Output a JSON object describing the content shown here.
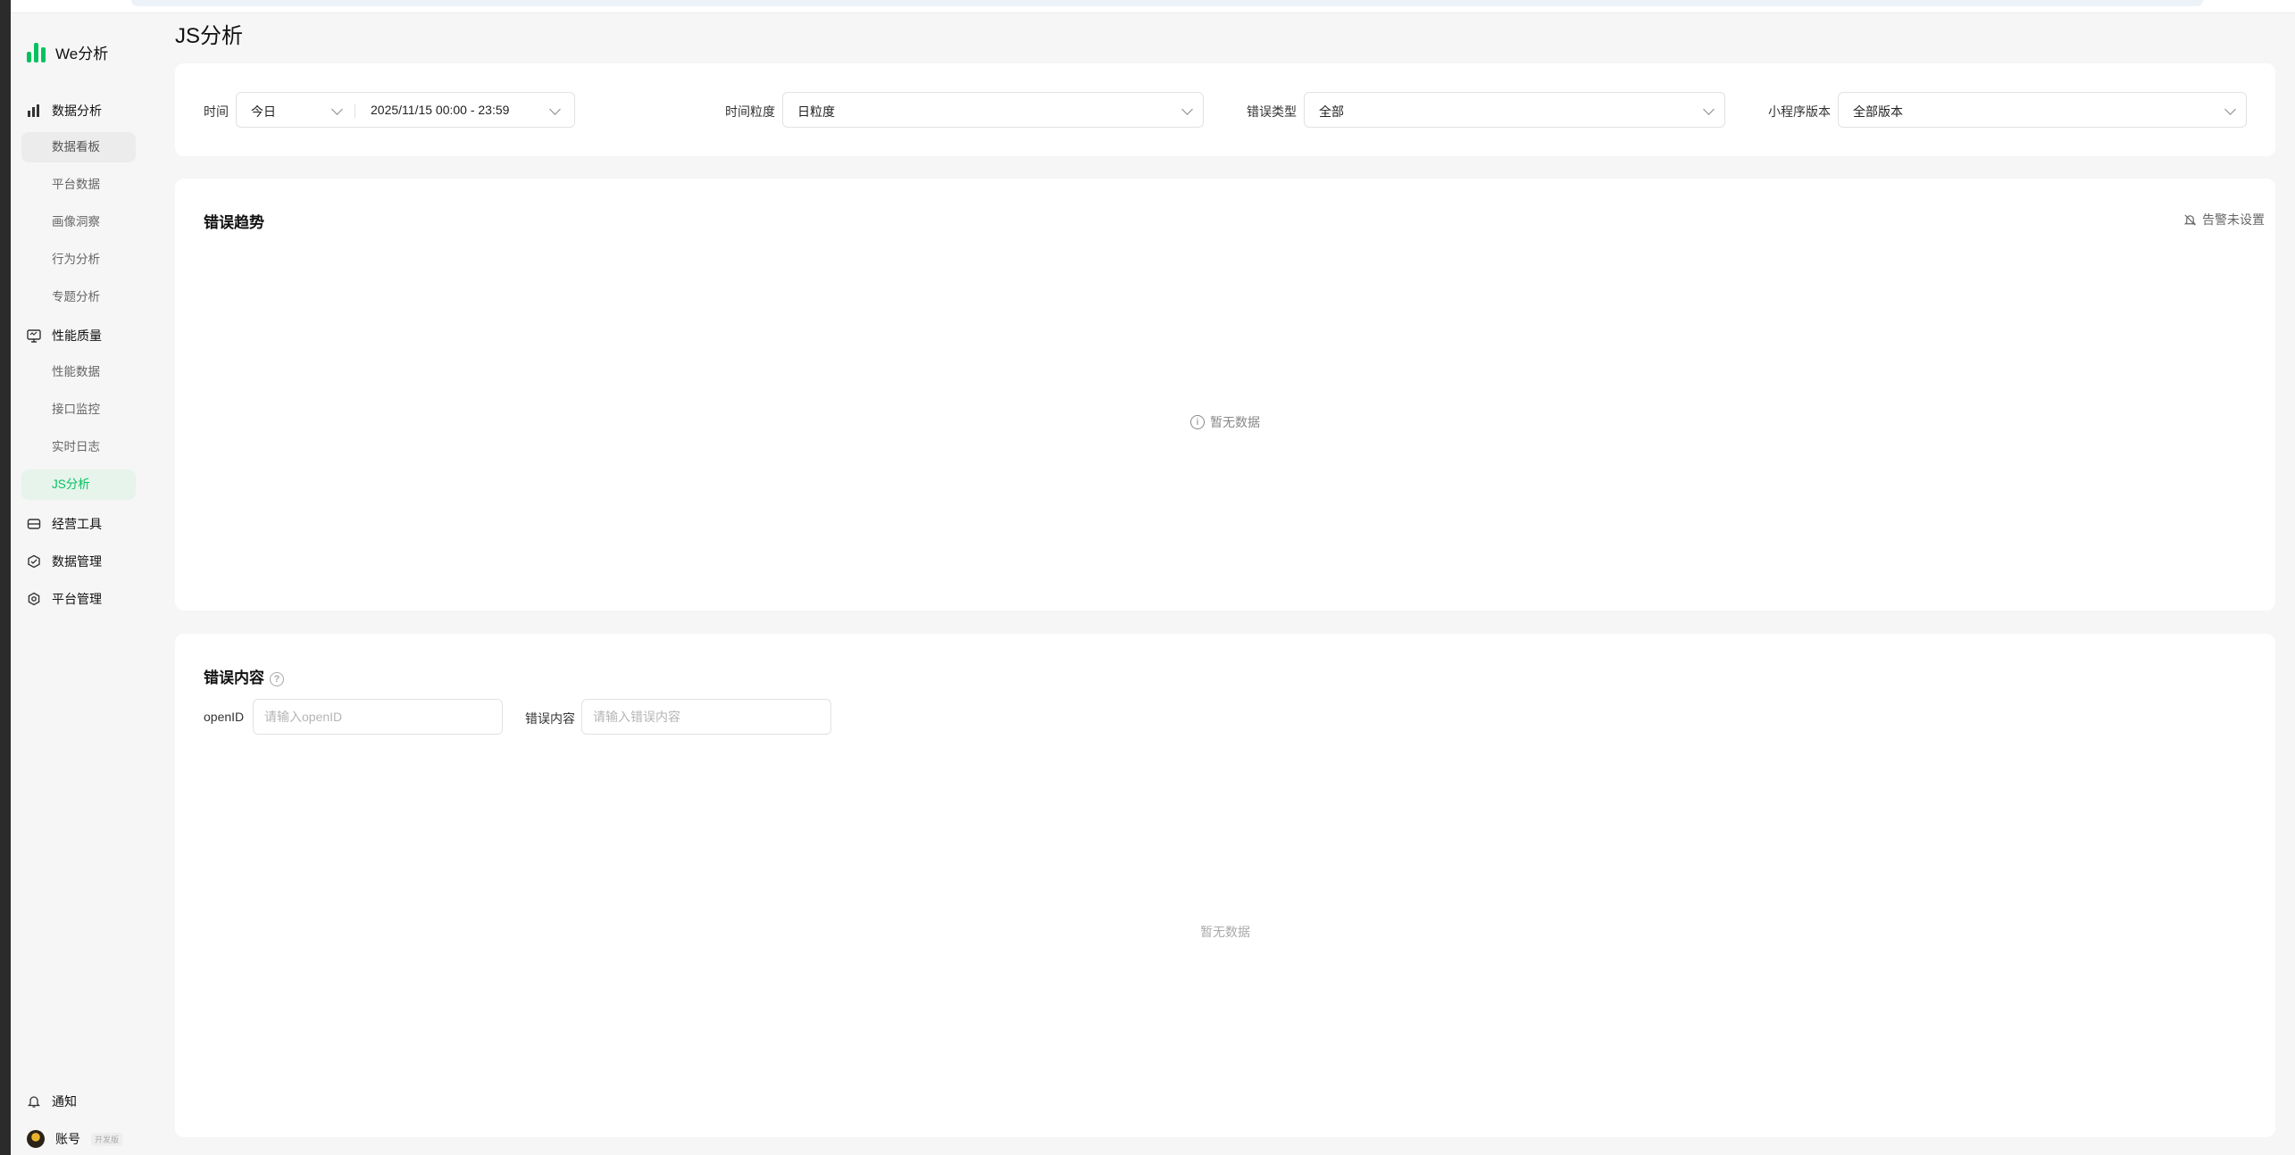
{
  "sidebar": {
    "brand": "We分析",
    "groups": {
      "data_analysis": {
        "label": "数据分析",
        "items": [
          "数据看板",
          "平台数据",
          "画像洞察",
          "行为分析",
          "专题分析"
        ]
      },
      "performance": {
        "label": "性能质量",
        "items": [
          "性能数据",
          "接口监控",
          "实时日志",
          "JS分析"
        ]
      },
      "operations": {
        "label": "经营工具"
      },
      "data_management": {
        "label": "数据管理"
      },
      "platform_management": {
        "label": "平台管理"
      }
    },
    "bottom": {
      "notify": "通知",
      "account": "账号",
      "account_badge": "开发版"
    },
    "active_item": "JS分析"
  },
  "page": {
    "title": "JS分析"
  },
  "filters": {
    "time_label": "时间",
    "time_preset": "今日",
    "time_range": "2025/11/15 00:00 - 23:59",
    "granularity_label": "时间粒度",
    "granularity_value": "日粒度",
    "error_type_label": "错误类型",
    "error_type_value": "全部",
    "version_label": "小程序版本",
    "version_value": "全部版本"
  },
  "trend": {
    "title": "错误趋势",
    "alert_text": "告警未设置",
    "empty_text": "暂无数据"
  },
  "content": {
    "title": "错误内容",
    "help": "?",
    "openid_label": "openID",
    "openid_placeholder": "请输入openID",
    "error_label": "错误内容",
    "error_placeholder": "请输入错误内容",
    "empty_text": "暂无数据"
  },
  "colors": {
    "accent": "#07c160",
    "active_bg": "#e6f4ec"
  }
}
